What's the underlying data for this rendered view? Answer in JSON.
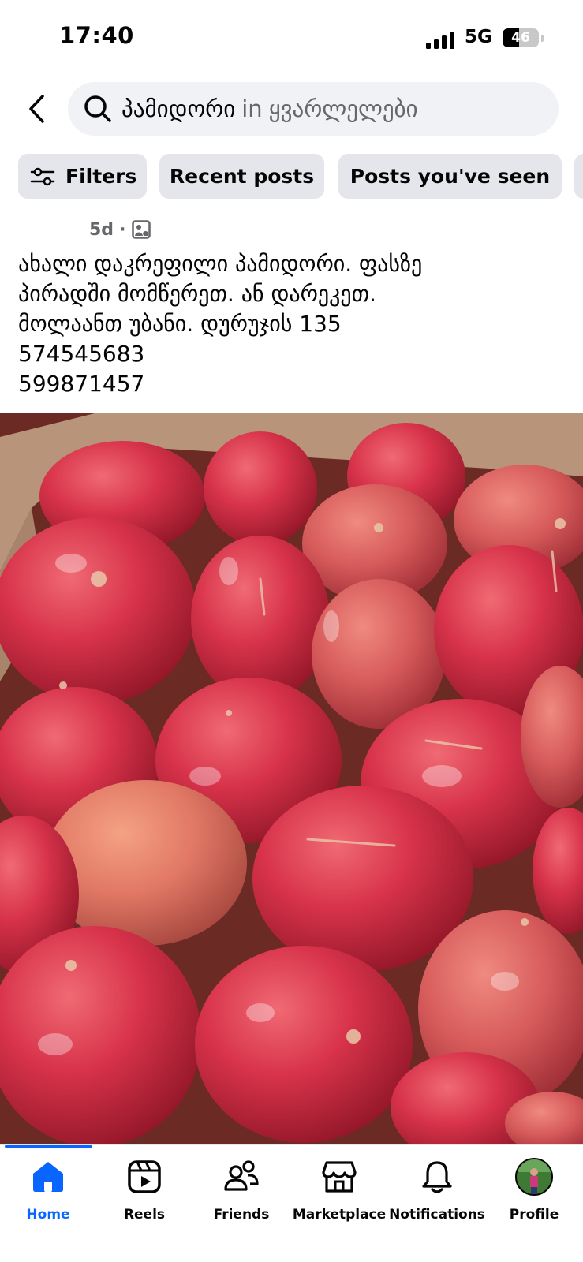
{
  "status_bar": {
    "time": "17:40",
    "network": "5G",
    "battery_percent": "46",
    "battery_level": 0.46,
    "signal_bars": 4
  },
  "search": {
    "query": "პამიდორი",
    "in_word": "in",
    "group_name": "ყვარლელები"
  },
  "filters": {
    "filters_label": "Filters",
    "recent_posts_label": "Recent posts",
    "posts_seen_label": "Posts you've seen"
  },
  "post": {
    "time_ago": "5d",
    "separator": "·",
    "text_lines": [
      "ახალი დაკრეფილი პამიდორი. ფასზე",
      "პირადში მომწერეთ. ან დარეკეთ.",
      "მოლაანთ უბანი. დურუჯის 135",
      "574545683",
      "599871457"
    ]
  },
  "bottom_nav": {
    "items": [
      {
        "label": "Home",
        "icon": "home-icon",
        "active": true
      },
      {
        "label": "Reels",
        "icon": "reels-icon",
        "active": false
      },
      {
        "label": "Friends",
        "icon": "friends-icon",
        "active": false
      },
      {
        "label": "Marketplace",
        "icon": "marketplace-icon",
        "active": false
      },
      {
        "label": "Notifications",
        "icon": "bell-icon",
        "active": false
      },
      {
        "label": "Profile",
        "icon": "avatar",
        "active": false
      }
    ]
  },
  "colors": {
    "accent": "#0866ff",
    "chip_bg": "#e4e6eb",
    "search_bg": "#f0f2f5",
    "secondary_text": "#65676b"
  }
}
